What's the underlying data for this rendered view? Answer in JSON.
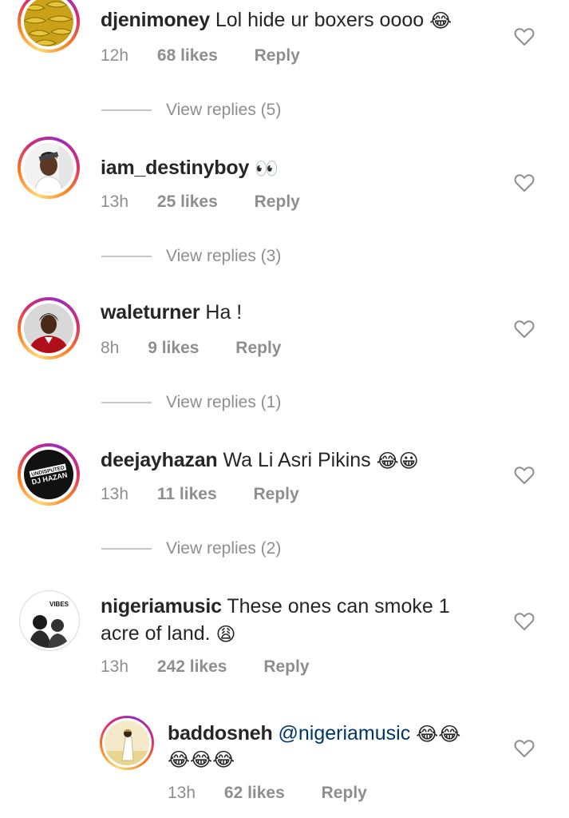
{
  "comments": [
    {
      "username": "djenimoney",
      "text": "Lol hide ur boxers oooo",
      "emoji": "😂",
      "time": "12h",
      "likes": "68 likes",
      "reply": "Reply",
      "view_replies": "View replies (5)"
    },
    {
      "username": "iam_destinyboy",
      "text": "",
      "emoji": "👀",
      "time": "13h",
      "likes": "25 likes",
      "reply": "Reply",
      "view_replies": "View replies (3)"
    },
    {
      "username": "waleturner",
      "text": "Ha !",
      "time": "8h",
      "likes": "9 likes",
      "reply": "Reply",
      "view_replies": "View replies (1)"
    },
    {
      "username": "deejayhazan",
      "text": "Wa Li Asri Pikins",
      "emoji": "😂😀",
      "time": "13h",
      "likes": "11 likes",
      "reply": "Reply",
      "view_replies": "View replies (2)",
      "avatar_text_1": "UNDISPUTED",
      "avatar_text_2": "DJ HAZAN"
    },
    {
      "username": "nigeriamusic",
      "text": "These ones can smoke 1",
      "text_line2": "acre of land.",
      "emoji": "😩",
      "time": "13h",
      "likes": "242 likes",
      "reply": "Reply",
      "avatar_text": "VIBES"
    },
    {
      "username": "baddosneh",
      "mention": "@nigeriamusic",
      "emoji": "😂😂",
      "emoji_line2": "😂😂😂",
      "time": "13h",
      "likes": "62 likes",
      "reply": "Reply"
    }
  ],
  "colors": {
    "text": "#262626",
    "meta": "#8e8e8e",
    "mention": "#003569",
    "ring_gradient": [
      "#feda75",
      "#fa7e1e",
      "#d62976",
      "#962fbf"
    ]
  },
  "icons": {
    "like": "heart-outline-icon"
  }
}
